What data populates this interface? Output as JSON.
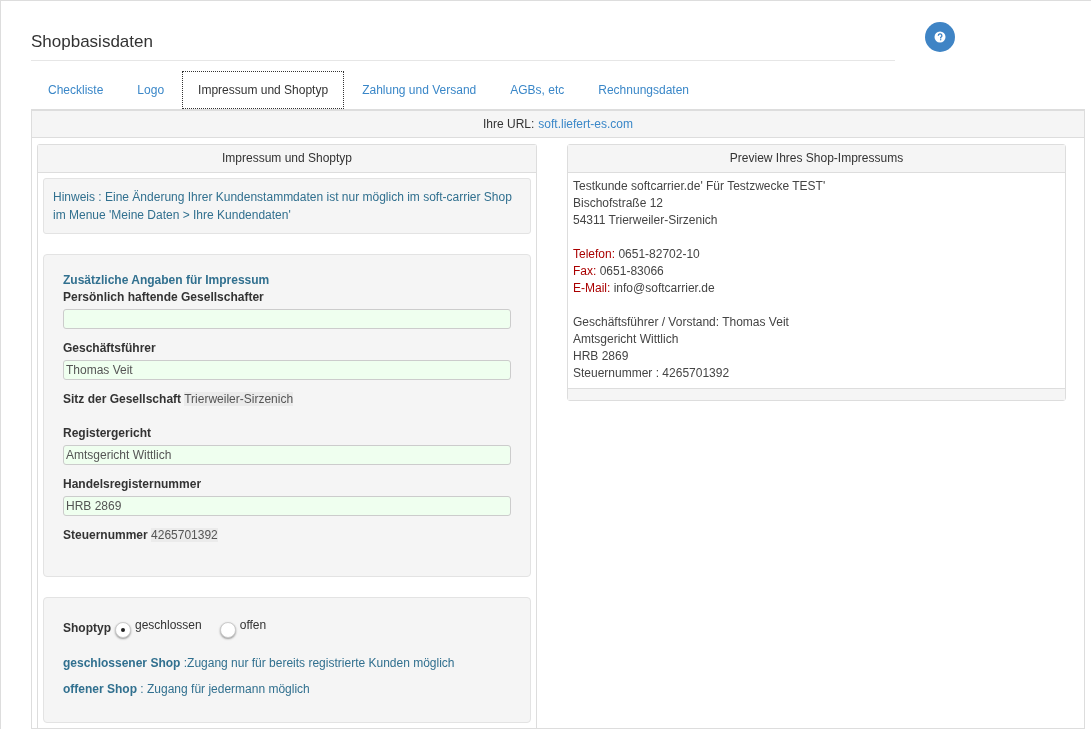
{
  "title": "Shopbasisdaten",
  "tabs": [
    {
      "label": "Checkliste",
      "selected": false
    },
    {
      "label": "Logo",
      "selected": false
    },
    {
      "label": "Impressum und Shoptyp",
      "selected": true
    },
    {
      "label": "Zahlung und Versand",
      "selected": false
    },
    {
      "label": "AGBs, etc",
      "selected": false
    },
    {
      "label": "Rechnungsdaten",
      "selected": false
    }
  ],
  "url": {
    "label": "Ihre URL:",
    "link": "soft.liefert-es.com"
  },
  "form_panel": {
    "title": "Impressum und Shoptyp",
    "notice": "Hinweis : Eine Änderung Ihrer Kundenstammdaten ist nur möglich im soft-carrier Shop im Menue 'Meine Daten > Ihre Kundendaten'",
    "impressum": {
      "heading": "Zusätzliche Angaben für Impressum",
      "fields": [
        {
          "kind": "input",
          "label": "Persönlich haftende Gesellschafter"
        },
        {
          "kind": "input",
          "label": "Geschäftsführer",
          "value": "Thomas Veit"
        },
        {
          "kind": "inline",
          "label": "Sitz der Gesellschaft",
          "value": "Trierweiler-Sirzenich"
        },
        {
          "kind": "input",
          "label": "Registergericht",
          "value": "Amtsgericht Wittlich"
        },
        {
          "kind": "input",
          "label": "Handelsregisternummer",
          "value": "HRB 2869"
        },
        {
          "kind": "inline",
          "label": "Steuernummer",
          "value": "4265701392"
        }
      ]
    },
    "shoptyp": {
      "label": "Shoptyp",
      "options": [
        {
          "label": "geschlossen",
          "selected": true
        },
        {
          "label": "offen",
          "selected": false
        }
      ],
      "descriptions": [
        {
          "term": "geschlossener Shop",
          "text": ":Zugang nur für bereits registrierte Kunden möglich"
        },
        {
          "term": "offener Shop",
          "text": ": Zugang für jedermann möglich"
        }
      ]
    }
  },
  "preview": {
    "title": "Preview Ihres Shop-Impressums",
    "blocks": [
      [
        {
          "text": "Testkunde softcarrier.de' Für Testzwecke TEST'"
        },
        {
          "text": "Bischofstraße 12"
        },
        {
          "text": "54311 Trierweiler-Sirzenich"
        }
      ],
      [
        {
          "label": "Telefon:",
          "text": "0651-82702-10"
        },
        {
          "label": "Fax:",
          "text": "0651-83066"
        },
        {
          "label": "E-Mail:",
          "text": "info@softcarrier.de"
        }
      ],
      [
        {
          "text": "Geschäftsführer / Vorstand: Thomas Veit"
        },
        {
          "text": "Amtsgericht Wittlich"
        },
        {
          "text": "HRB 2869"
        },
        {
          "text": "Steuernummer : 4265701392"
        }
      ]
    ]
  }
}
